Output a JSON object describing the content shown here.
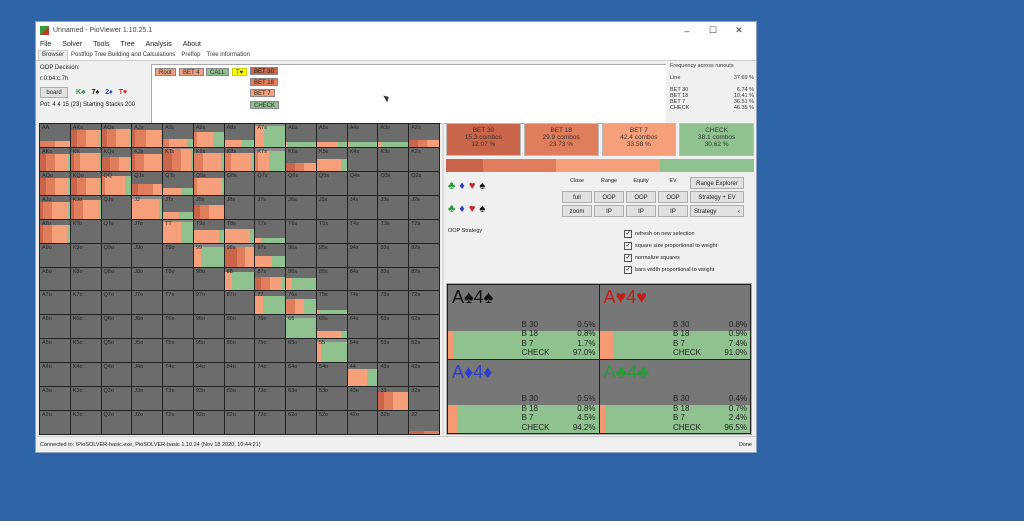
{
  "window": {
    "title": "Unnamed - PioViewer 1.10.25.1",
    "controls": {
      "minimize": "–",
      "maximize": "☐",
      "close": "✕"
    }
  },
  "menu": [
    "File",
    "Solver",
    "Tools",
    "Tree",
    "Analysis",
    "About"
  ],
  "tabs": [
    {
      "label": "Browser",
      "active": true
    },
    {
      "label": "Postflop Tree Building and Calculations",
      "active": false
    },
    {
      "label": "Preflop",
      "active": false
    },
    {
      "label": "Tree information",
      "active": false
    }
  ],
  "decision": {
    "title": "OOP Decision:",
    "line": "r:0:b4:c:7h",
    "board_button": "board",
    "board_cards": [
      {
        "text": "K♣",
        "color": "#2a9a3a"
      },
      {
        "text": "7♠",
        "color": "#111111"
      },
      {
        "text": "2♦",
        "color": "#2a3fd0"
      },
      {
        "text": "T♥",
        "color": "#d02020"
      }
    ],
    "pot_info": "Pot: 4 4 15 (23) Starting Stacks 200"
  },
  "tree_nodes": [
    {
      "label": "Root",
      "color": "#f0a080"
    },
    {
      "label": "BET 4",
      "color": "#f0a080"
    },
    {
      "label": "CALL",
      "color": "#8fc28f"
    },
    {
      "label": "T♥",
      "color": "#ffff00"
    },
    {
      "label": "BET 30",
      "color": "#c8654a"
    },
    {
      "label": "BET 18",
      "color": "#e07d5c"
    },
    {
      "label": "BET 7",
      "color": "#f5a07a"
    },
    {
      "label": "CHECK",
      "color": "#8fc28f"
    }
  ],
  "frequency": {
    "title": "Frequency across runouts",
    "line_label": "Line",
    "line_value": "37.69 %",
    "rows": [
      {
        "label": "BET 30",
        "value": "6.74 %"
      },
      {
        "label": "BET 18",
        "value": "10.41 %"
      },
      {
        "label": "BET 7",
        "value": "36.51 %"
      },
      {
        "label": "CHECK",
        "value": "46.35 %"
      }
    ]
  },
  "actions": [
    {
      "name": "BET 30",
      "combos": "15.3 combos",
      "pct": "12.07 %",
      "share": 12.07,
      "color": "#c8654a"
    },
    {
      "name": "BET 18",
      "combos": "29.9 combos",
      "pct": "23.73 %",
      "share": 23.73,
      "color": "#e07d5c"
    },
    {
      "name": "BET 7",
      "combos": "42.4 combos",
      "pct": "33.58 %",
      "share": 33.58,
      "color": "#f5a07a"
    },
    {
      "name": "CHECK",
      "combos": "38.1 combos",
      "pct": "30.62 %",
      "share": 30.62,
      "color": "#8fc28f"
    }
  ],
  "suit_rows": [
    [
      {
        "s": "♣",
        "c": "#2a9a3a"
      },
      {
        "s": "♦",
        "c": "#2a3fd0"
      },
      {
        "s": "♥",
        "c": "#d02020"
      },
      {
        "s": "♠",
        "c": "#111111"
      }
    ],
    [
      {
        "s": "♣",
        "c": "#2a9a3a"
      },
      {
        "s": "♦",
        "c": "#2a3fd0"
      },
      {
        "s": "♥",
        "c": "#d02020"
      },
      {
        "s": "♠",
        "c": "#111111"
      }
    ]
  ],
  "strategy_label": "OOP Strategy",
  "options": {
    "headers": [
      "Close",
      "Range",
      "Equity",
      "EV"
    ],
    "range_explorer": "Range Explorer",
    "row1": [
      "full",
      "OOP",
      "OOP",
      "OOP",
      "Strategy + EV"
    ],
    "row2": [
      "zoom",
      "IP",
      "IP",
      "IP",
      "Strategy"
    ],
    "dropdown_arrow": "‹"
  },
  "checkboxes": [
    {
      "label": "refresh on new selection",
      "checked": true
    },
    {
      "label": "square size proportional to weight",
      "checked": true
    },
    {
      "label": "normalize squares",
      "checked": true
    },
    {
      "label": "bars width proportional to weight",
      "checked": true
    }
  ],
  "combos": [
    {
      "name": "A♠4♠",
      "color": "#111111",
      "rows": [
        [
          "B 30",
          "0.5%"
        ],
        [
          "B 18",
          "0.8%"
        ],
        [
          "B 7",
          "1.7%"
        ],
        [
          "CHECK",
          "97.0%"
        ]
      ],
      "bet_share": 3.0
    },
    {
      "name": "A♥4♥",
      "color": "#c0201a",
      "rows": [
        [
          "B 30",
          "0.8%"
        ],
        [
          "B 18",
          "0.9%"
        ],
        [
          "B 7",
          "7.4%"
        ],
        [
          "CHECK",
          "91.0%"
        ]
      ],
      "bet_share": 9.0
    },
    {
      "name": "A♦4♦",
      "color": "#2a3fd0",
      "rows": [
        [
          "B 30",
          "0.5%"
        ],
        [
          "B 18",
          "0.8%"
        ],
        [
          "B 7",
          "4.5%"
        ],
        [
          "CHECK",
          "94.2%"
        ]
      ],
      "bet_share": 5.8
    },
    {
      "name": "A♣4♣",
      "color": "#2a9a3a",
      "rows": [
        [
          "B 30",
          "0.4%"
        ],
        [
          "B 18",
          "0.7%"
        ],
        [
          "B 7",
          "2.4%"
        ],
        [
          "CHECK",
          "96.5%"
        ]
      ],
      "bet_share": 3.5
    }
  ],
  "grid_ranks": [
    "A",
    "K",
    "Q",
    "J",
    "T",
    "9",
    "8",
    "7",
    "6",
    "5",
    "4",
    "3",
    "2"
  ],
  "grid_cells": {
    "AA": {
      "w": 0.25,
      "mix": [
        0,
        0.5,
        0.5,
        0
      ]
    },
    "AKs": {
      "w": 0.75,
      "mix": [
        0.2,
        0.3,
        0.45,
        0.05
      ]
    },
    "AQs": {
      "w": 0.8,
      "mix": [
        0.2,
        0.3,
        0.45,
        0.05
      ]
    },
    "AJs": {
      "w": 0.75,
      "mix": [
        0.1,
        0.35,
        0.5,
        0.05
      ]
    },
    "ATs": {
      "w": 0.35,
      "mix": [
        0,
        0.2,
        0.6,
        0.2
      ]
    },
    "A9s": {
      "w": 0.65,
      "mix": [
        0,
        0.1,
        0.55,
        0.35
      ]
    },
    "A8s": {
      "w": 0.3,
      "mix": [
        0,
        0,
        0.6,
        0.4
      ]
    },
    "A7s": {
      "w": 0.9,
      "mix": [
        0,
        0,
        0.3,
        0.7
      ]
    },
    "A6s": {
      "w": 0.2,
      "mix": [
        0,
        0,
        0.05,
        0.95
      ]
    },
    "A5s": {
      "w": 0.2,
      "mix": [
        0,
        0,
        0.7,
        0.3
      ]
    },
    "A4s": {
      "w": 0.2,
      "mix": [
        0,
        0,
        0.05,
        0.95
      ]
    },
    "A3s": {
      "w": 0.2,
      "mix": [
        0,
        0,
        0.1,
        0.9
      ]
    },
    "A2s": {
      "w": 0.3,
      "mix": [
        0.3,
        0.3,
        0.4,
        0
      ]
    },
    "AKo": {
      "w": 0.75,
      "mix": [
        0.2,
        0.3,
        0.45,
        0.05
      ]
    },
    "KK": {
      "w": 0.8,
      "mix": [
        0.1,
        0.2,
        0.65,
        0.05
      ]
    },
    "KQs": {
      "w": 0.6,
      "mix": [
        0.3,
        0.3,
        0.35,
        0.05
      ]
    },
    "KJs": {
      "w": 0.75,
      "mix": [
        0.1,
        0.3,
        0.55,
        0.05
      ]
    },
    "KTs": {
      "w": 0.95,
      "mix": [
        0.3,
        0.3,
        0.35,
        0.05
      ]
    },
    "K9s": {
      "w": 0.8,
      "mix": [
        0,
        0.3,
        0.6,
        0.1
      ]
    },
    "K8s": {
      "w": 0.8,
      "mix": [
        0,
        0.2,
        0.7,
        0.1
      ]
    },
    "K7s": {
      "w": 0.85,
      "mix": [
        0,
        0.1,
        0.35,
        0.55
      ]
    },
    "K6s": {
      "w": 0.35,
      "mix": [
        0.3,
        0.3,
        0.4,
        0
      ]
    },
    "K5s": {
      "w": 0.5,
      "mix": [
        0,
        0,
        0.8,
        0.2
      ]
    },
    "AQo": {
      "w": 0.75,
      "mix": [
        0.2,
        0.3,
        0.45,
        0.05
      ]
    },
    "KQo": {
      "w": 0.75,
      "mix": [
        0.2,
        0.3,
        0.45,
        0.05
      ]
    },
    "QQ": {
      "w": 0.8,
      "mix": [
        0,
        0.1,
        0.7,
        0.2
      ]
    },
    "QJs": {
      "w": 0.45,
      "mix": [
        0.2,
        0.5,
        0.3,
        0
      ]
    },
    "QTs": {
      "w": 0.3,
      "mix": [
        0,
        0,
        0.6,
        0.4
      ]
    },
    "Q9s": {
      "w": 0.75,
      "mix": [
        0,
        0.1,
        0.85,
        0.05
      ]
    },
    "AJo": {
      "w": 0.75,
      "mix": [
        0.1,
        0.3,
        0.55,
        0.05
      ]
    },
    "KJo": {
      "w": 0.8,
      "mix": [
        0.1,
        0.3,
        0.55,
        0.05
      ]
    },
    "JJ": {
      "w": 0.85,
      "mix": [
        0,
        0,
        0.9,
        0.1
      ]
    },
    "JTs": {
      "w": 0.3,
      "mix": [
        0,
        0,
        0.55,
        0.45
      ]
    },
    "J9s": {
      "w": 0.6,
      "mix": [
        0.2,
        0.3,
        0.5,
        0
      ]
    },
    "ATo": {
      "w": 0.75,
      "mix": [
        0.1,
        0.3,
        0.5,
        0.1
      ]
    },
    "TT": {
      "w": 0.9,
      "mix": [
        0,
        0,
        0.6,
        0.4
      ]
    },
    "T9s": {
      "w": 0.55,
      "mix": [
        0,
        0,
        0.85,
        0.15
      ]
    },
    "T8s": {
      "w": 0.6,
      "mix": [
        0,
        0,
        0.85,
        0.15
      ]
    },
    "T7s": {
      "w": 0.2,
      "mix": [
        0,
        0,
        0.2,
        0.8
      ]
    },
    "99": {
      "w": 0.85,
      "mix": [
        0,
        0,
        0.25,
        0.75
      ]
    },
    "98s": {
      "w": 0.85,
      "mix": [
        0.4,
        0.3,
        0.3,
        0
      ]
    },
    "97s": {
      "w": 0.45,
      "mix": [
        0,
        0,
        0.55,
        0.45
      ]
    },
    "88": {
      "w": 0.8,
      "mix": [
        0,
        0,
        0.25,
        0.75
      ]
    },
    "87s": {
      "w": 0.6,
      "mix": [
        0.2,
        0.3,
        0.4,
        0.1
      ]
    },
    "86s": {
      "w": 0.55,
      "mix": [
        0,
        0,
        0.2,
        0.8
      ]
    },
    "77": {
      "w": 0.8,
      "mix": [
        0,
        0,
        0.25,
        0.75
      ]
    },
    "76s": {
      "w": 0.65,
      "mix": [
        0,
        0.3,
        0.3,
        0.4
      ]
    },
    "75s": {
      "w": 0.2,
      "mix": [
        0,
        0,
        0.1,
        0.9
      ]
    },
    "66": {
      "w": 0.9,
      "mix": [
        0,
        0,
        0,
        1
      ]
    },
    "65s": {
      "w": 0.3,
      "mix": [
        0,
        0,
        0.8,
        0.2
      ]
    },
    "55": {
      "w": 0.9,
      "mix": [
        0,
        0,
        0.15,
        0.85
      ]
    },
    "44": {
      "w": 0.75,
      "mix": [
        0,
        0,
        0.65,
        0.35
      ]
    },
    "33": {
      "w": 0.8,
      "mix": [
        0.2,
        0.3,
        0.5,
        0
      ]
    },
    "22": {
      "w": 0.12,
      "mix": [
        0.5,
        0.5,
        0,
        0
      ]
    }
  },
  "status": {
    "left": "Connected to: \\PioSOLVER-basic.exe, PioSOLVER-basic 1.10.24 (Nov 18 2020, 10:44:21)",
    "right": "Done"
  }
}
